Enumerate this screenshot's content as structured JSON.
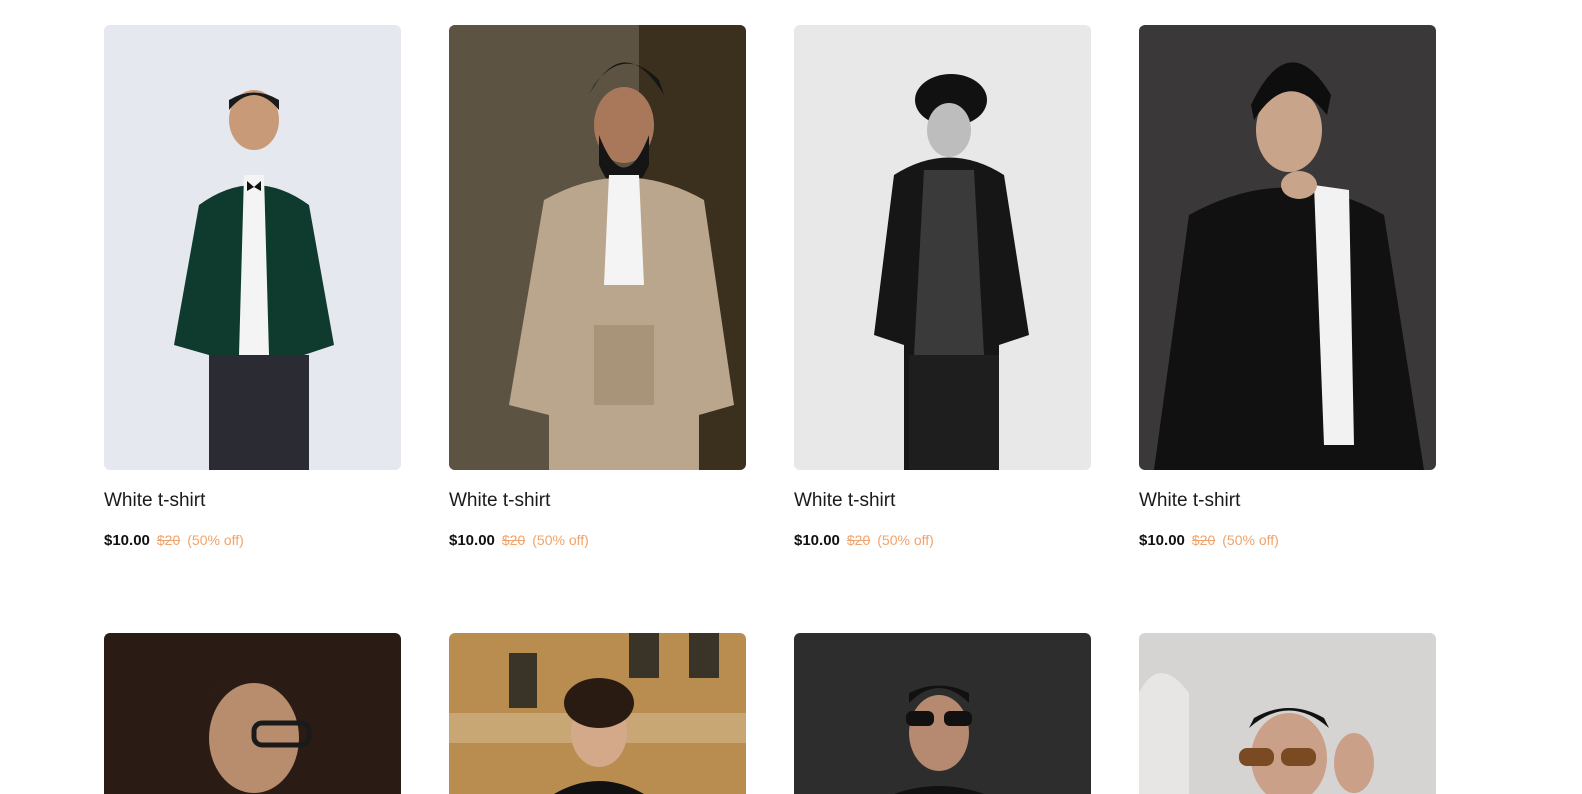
{
  "products": [
    {
      "title": "White t-shirt",
      "price": "$10.00",
      "old_price": "$20",
      "discount": "(50% off)",
      "bg": "#e6e8ef",
      "jacket": "#0f3a2e",
      "skin": "#c99a78",
      "hair": "#1a1a1a"
    },
    {
      "title": "White t-shirt",
      "price": "$10.00",
      "old_price": "$20",
      "discount": "(50% off)",
      "bg": "#3b2f1e",
      "jacket": "#b9a68d",
      "skin": "#a9785a",
      "hair": "#151515"
    },
    {
      "title": "White t-shirt",
      "price": "$10.00",
      "old_price": "$20",
      "discount": "(50% off)",
      "bg": "#e8e8e8",
      "jacket": "#161616",
      "skin": "#bdbdbd",
      "hair": "#111111"
    },
    {
      "title": "White t-shirt",
      "price": "$10.00",
      "old_price": "$20",
      "discount": "(50% off)",
      "bg": "#3a3838",
      "jacket": "#111111",
      "skin": "#c8a48a",
      "hair": "#0e0e0e"
    },
    {
      "title": "",
      "price": "",
      "old_price": "",
      "discount": "",
      "bg": "#2a1c14",
      "jacket": "#1a120d",
      "skin": "#b88d6e",
      "hair": "#2b1d14"
    },
    {
      "title": "",
      "price": "",
      "old_price": "",
      "discount": "",
      "bg": "#b98d4f",
      "jacket": "#111111",
      "skin": "#d4a98a",
      "hair": "#2a1b12"
    },
    {
      "title": "",
      "price": "",
      "old_price": "",
      "discount": "",
      "bg": "#2d2d2d",
      "jacket": "#111111",
      "skin": "#b58a70",
      "hair": "#111111"
    },
    {
      "title": "",
      "price": "",
      "old_price": "",
      "discount": "",
      "bg": "#d6d4d2",
      "jacket": "#222222",
      "skin": "#caa088",
      "hair": "#111111"
    }
  ]
}
